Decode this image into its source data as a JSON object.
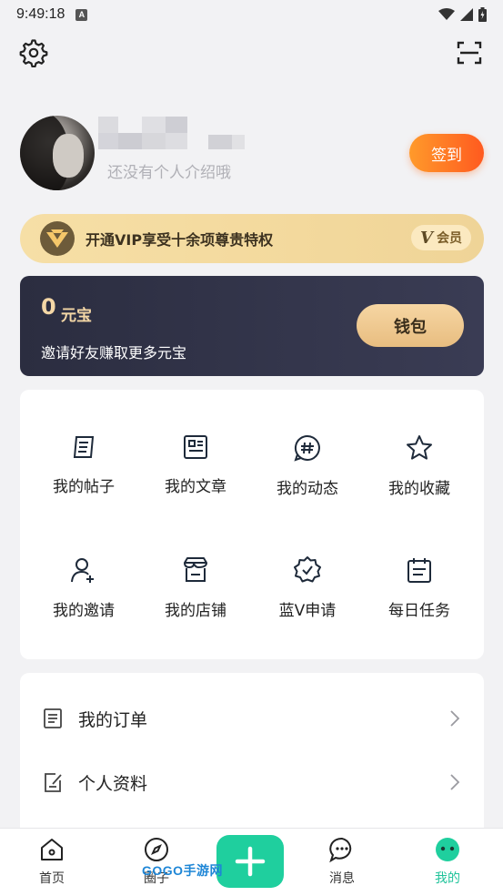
{
  "status_bar": {
    "time": "9:49:18",
    "badge": "A"
  },
  "profile": {
    "bio": "还没有个人介绍哦",
    "signin_label": "签到"
  },
  "vip": {
    "text": "开通VIP享受十余项尊贵特权",
    "tag_label": "会员",
    "tag_letter": "V"
  },
  "wallet": {
    "amount": "0",
    "unit": "元宝",
    "invite_text": "邀请好友赚取更多元宝",
    "button_label": "钱包"
  },
  "grid": [
    {
      "label": "我的帖子",
      "icon": "post-icon"
    },
    {
      "label": "我的文章",
      "icon": "article-icon"
    },
    {
      "label": "我的动态",
      "icon": "hashtag-icon"
    },
    {
      "label": "我的收藏",
      "icon": "star-icon"
    },
    {
      "label": "我的邀请",
      "icon": "invite-user-icon"
    },
    {
      "label": "我的店铺",
      "icon": "store-icon"
    },
    {
      "label": "蓝V申请",
      "icon": "verified-badge-icon"
    },
    {
      "label": "每日任务",
      "icon": "calendar-task-icon"
    }
  ],
  "list": [
    {
      "label": "我的订单",
      "icon": "order-icon"
    },
    {
      "label": "个人资料",
      "icon": "edit-profile-icon"
    }
  ],
  "bottom_nav": {
    "home": "首页",
    "discover": "圈子",
    "messages": "消息",
    "me": "我的"
  },
  "watermark": {
    "text": "GOGO",
    "hand": "手游网"
  },
  "colors": {
    "accent": "#1fcf9e",
    "signin_gradient": [
      "#ff9a2b",
      "#ff5a1f"
    ],
    "wallet_bg": "#2b2d40",
    "gold": "#f4d7a6"
  }
}
